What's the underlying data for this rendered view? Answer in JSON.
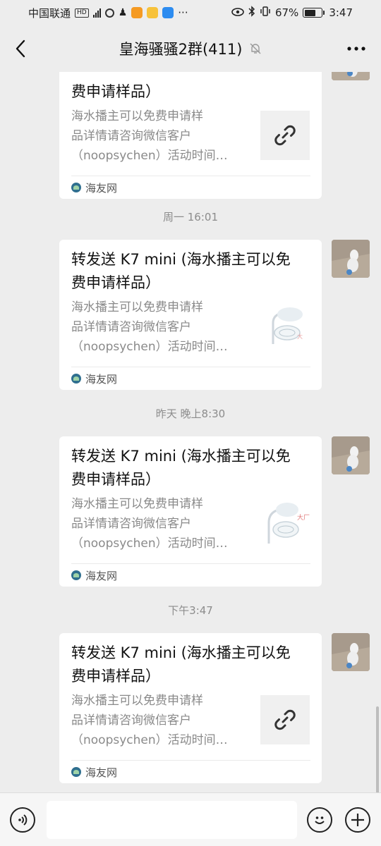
{
  "status_bar": {
    "carrier": "中国联通",
    "hd_badge": "HD",
    "network": "4G",
    "battery_percent": "67%",
    "battery_level": 0.67,
    "time": "3:47"
  },
  "nav": {
    "title": "皇海骚骚2群(411)",
    "back_icon": "chevron-left-icon",
    "mute_icon": "bell-off-icon",
    "more_icon": "more-horizontal-icon"
  },
  "messages": [
    {
      "title_line1": "",
      "title_line2": "费申请样品）",
      "desc": [
        "海水播主可以免费申请样",
        "品详情请咨询微信客户",
        "（noopsychen）活动时间…"
      ],
      "thumb": "link-icon",
      "source": "海友网"
    },
    {
      "timestamp": "周一 16:01",
      "title_line1": "转发送 K7 mini (海水播主可以免",
      "title_line2": "费申请样品）",
      "desc": [
        "海水播主可以免费申请样",
        "品详情请咨询微信客户",
        "（noopsychen）活动时间…"
      ],
      "thumb": "product-image",
      "source": "海友网"
    },
    {
      "timestamp": "昨天 晚上8:30",
      "title_line1": "转发送 K7 mini (海水播主可以免",
      "title_line2": "费申请样品）",
      "desc": [
        "海水播主可以免费申请样",
        "品详情请咨询微信客户",
        "（noopsychen）活动时间…"
      ],
      "thumb": "product-image",
      "source": "海友网"
    },
    {
      "timestamp": "下午3:47",
      "title_line1": "转发送 K7 mini (海水播主可以免",
      "title_line2": "费申请样品）",
      "desc": [
        "海水播主可以免费申请样",
        "品详情请咨询微信客户",
        "（noopsychen）活动时间…"
      ],
      "thumb": "link-icon",
      "source": "海友网"
    }
  ],
  "input_bar": {
    "placeholder": "",
    "voice_icon": "voice-icon",
    "emoji_icon": "emoji-icon",
    "plus_icon": "plus-icon"
  }
}
